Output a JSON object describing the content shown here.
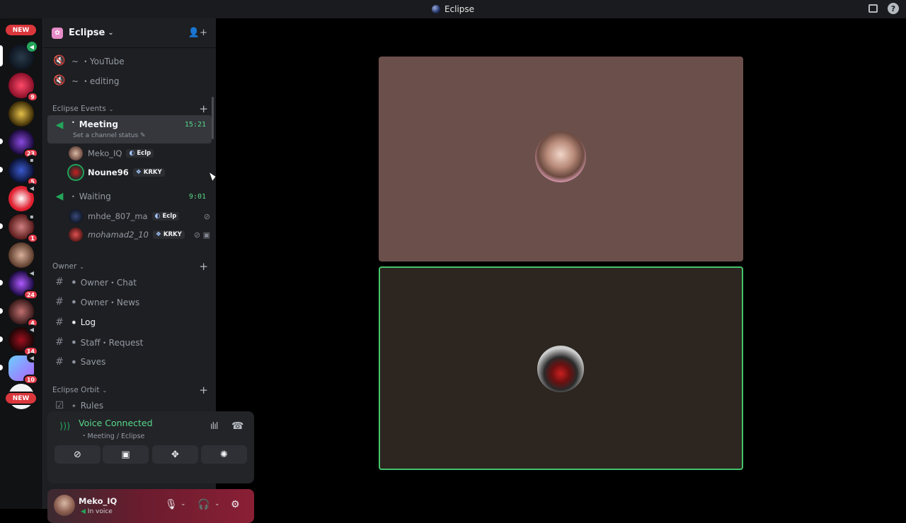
{
  "window": {
    "title": "Eclipse"
  },
  "rail": {
    "new_top": "NEW",
    "new_bottom": "NEW",
    "badges": [
      "9",
      "23",
      "5",
      "1",
      "24",
      "4",
      "14",
      "10"
    ]
  },
  "guild": {
    "name": "Eclipse"
  },
  "channels": {
    "youtube": "~ ・YouTube",
    "editing": "~ ・editing",
    "cat_events": "Eclipse Events",
    "meeting": "Meeting",
    "meeting_time": "15:21",
    "meeting_status": "Set a channel status",
    "waiting": "Waiting",
    "waiting_time": "9:01",
    "cat_owner": "Owner",
    "owner_chat": "Owner・Chat",
    "owner_news": "Owner・News",
    "log": "Log",
    "staff_request": "Staff・Request",
    "saves": "Saves",
    "cat_orbit": "Eclipse Orbit",
    "rules": "Rules"
  },
  "members": [
    {
      "name": "Meko_IQ",
      "tag": "Eclp"
    },
    {
      "name": "Noune96",
      "tag": "KRKY"
    },
    {
      "name": "mhde_807_ma",
      "tag": "Eclp"
    },
    {
      "name": "mohamad2_10",
      "tag": "KRKY"
    }
  ],
  "voice": {
    "title": "Voice Connected",
    "subtitle": "・Meeting / Eclipse"
  },
  "user": {
    "name": "Meko_IQ",
    "status": "In voice"
  },
  "colors": {
    "accent_green": "#23a55a",
    "new_badge": "#da373c",
    "tile_top": "#6b4f4b",
    "tile_bottom": "#2c2520"
  }
}
